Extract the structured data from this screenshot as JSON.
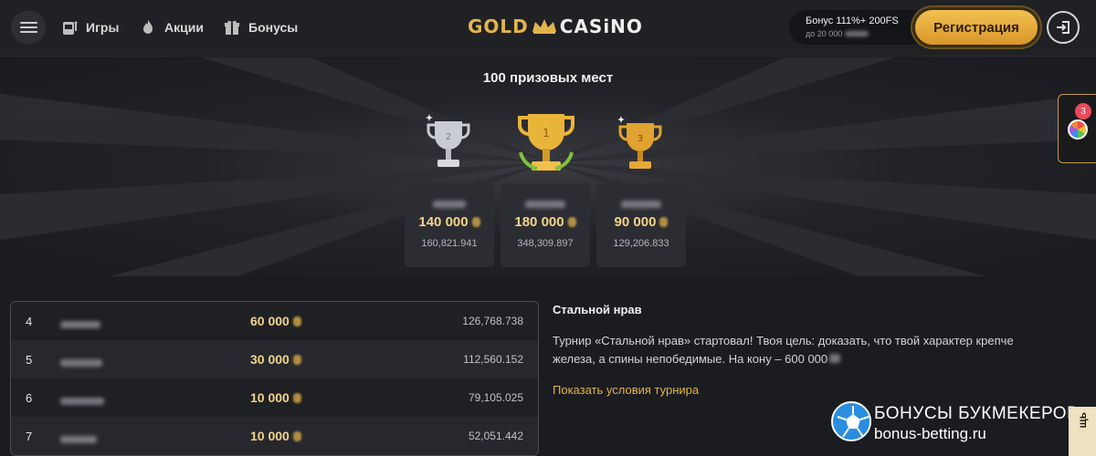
{
  "header": {
    "nav": [
      {
        "label": "Игры",
        "icon": "slot-machine-icon"
      },
      {
        "label": "Акции",
        "icon": "flame-icon"
      },
      {
        "label": "Бонусы",
        "icon": "gift-icon"
      }
    ],
    "logo": {
      "left": "GOLD",
      "right": "CASiNO"
    },
    "bonus": {
      "line1": "Бонус 111%+ 200FS",
      "line2": "до 20 000"
    },
    "register_label": "Регистрация"
  },
  "hero": {
    "title": "100 призовых мест",
    "podium": [
      {
        "place": "2",
        "amount": "140 000",
        "score": "160,821.941"
      },
      {
        "place": "1",
        "amount": "180 000",
        "score": "348,309.897"
      },
      {
        "place": "3",
        "amount": "90 000",
        "score": "129,206.833"
      }
    ]
  },
  "side_widget": {
    "badge": "3"
  },
  "table": {
    "rows": [
      {
        "pos": "4",
        "prize": "60 000",
        "score": "126,768.738"
      },
      {
        "pos": "5",
        "prize": "30 000",
        "score": "112,560.152"
      },
      {
        "pos": "6",
        "prize": "10 000",
        "score": "79,105.025"
      },
      {
        "pos": "7",
        "prize": "10 000",
        "score": "52,051.442"
      }
    ]
  },
  "tournament": {
    "title": "Стальной нрав",
    "text": "Турнир «Стальной нрав» стартовал! Твоя цель: доказать, что твой характер крепче железа, а спины непобедимые. На кону – 600 000",
    "link": "Показать условия турнира"
  },
  "watermark": {
    "title": "БОНУСЫ БУКМЕКЕРОВ",
    "url": "bonus-betting.ru"
  },
  "help_tab": "щь",
  "colors": {
    "gold": "#e2b44c",
    "amount": "#f3d48a",
    "background": "#1b1c20"
  }
}
